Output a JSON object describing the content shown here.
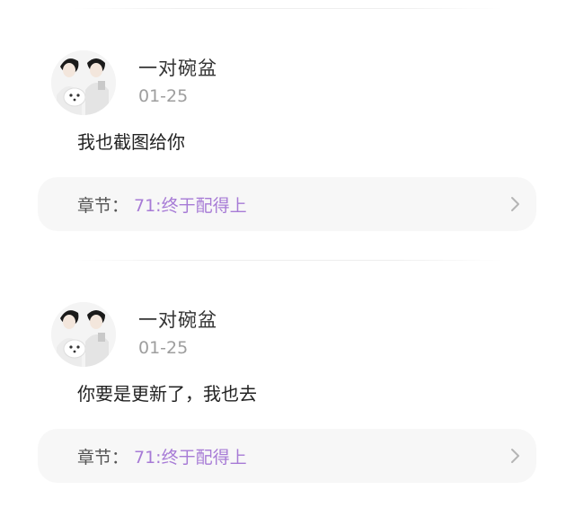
{
  "comments": [
    {
      "user": "一对碗盆",
      "date": "01-25",
      "text": "我也截图给你",
      "chapter_label": "章节：",
      "chapter_title": "71:终于配得上"
    },
    {
      "user": "一对碗盆",
      "date": "01-25",
      "text": "你要是更新了，我也去",
      "chapter_label": "章节：",
      "chapter_title": "71:终于配得上"
    }
  ],
  "colors": {
    "accent": "#a77bd6",
    "card_bg": "#f7f7f7",
    "date": "#9e9e9e"
  },
  "icons": {
    "avatar": "avatar-image",
    "chevron": "chevron-right-icon"
  }
}
